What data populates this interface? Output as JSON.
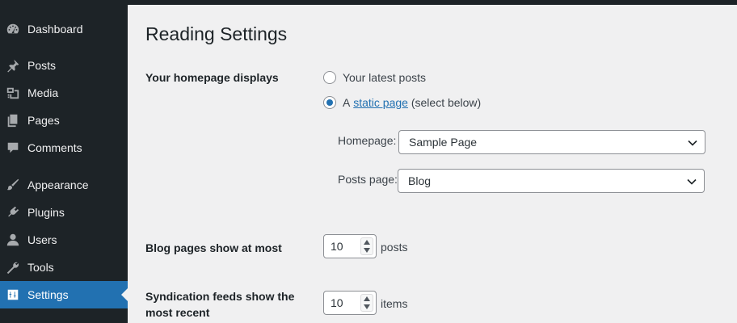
{
  "sidebar": {
    "items": [
      {
        "label": "Dashboard",
        "icon": "dashboard-icon"
      },
      {
        "label": "Posts",
        "icon": "pin-icon"
      },
      {
        "label": "Media",
        "icon": "media-icon"
      },
      {
        "label": "Pages",
        "icon": "pages-icon"
      },
      {
        "label": "Comments",
        "icon": "comment-icon"
      },
      {
        "label": "Appearance",
        "icon": "brush-icon"
      },
      {
        "label": "Plugins",
        "icon": "plugin-icon"
      },
      {
        "label": "Users",
        "icon": "user-icon"
      },
      {
        "label": "Tools",
        "icon": "wrench-icon"
      },
      {
        "label": "Settings",
        "icon": "settings-icon",
        "active": true
      }
    ],
    "active_color": "#2271b1",
    "background": "#1d2327"
  },
  "page": {
    "title": "Reading Settings"
  },
  "homepage_displays": {
    "label": "Your homepage displays",
    "option_latest": "Your latest posts",
    "option_static_prefix": "A",
    "option_static_link": "static page",
    "option_static_suffix": "(select below)",
    "selected": "static page",
    "homepage_label": "Homepage:",
    "homepage_value": "Sample Page",
    "posts_page_label": "Posts page:",
    "posts_page_value": "Blog"
  },
  "blog_pages": {
    "label": "Blog pages show at most",
    "value": "10",
    "unit": "posts"
  },
  "syndication": {
    "label_line1": "Syndication feeds show the",
    "label_line2": "most recent",
    "value": "10",
    "unit": "items"
  }
}
